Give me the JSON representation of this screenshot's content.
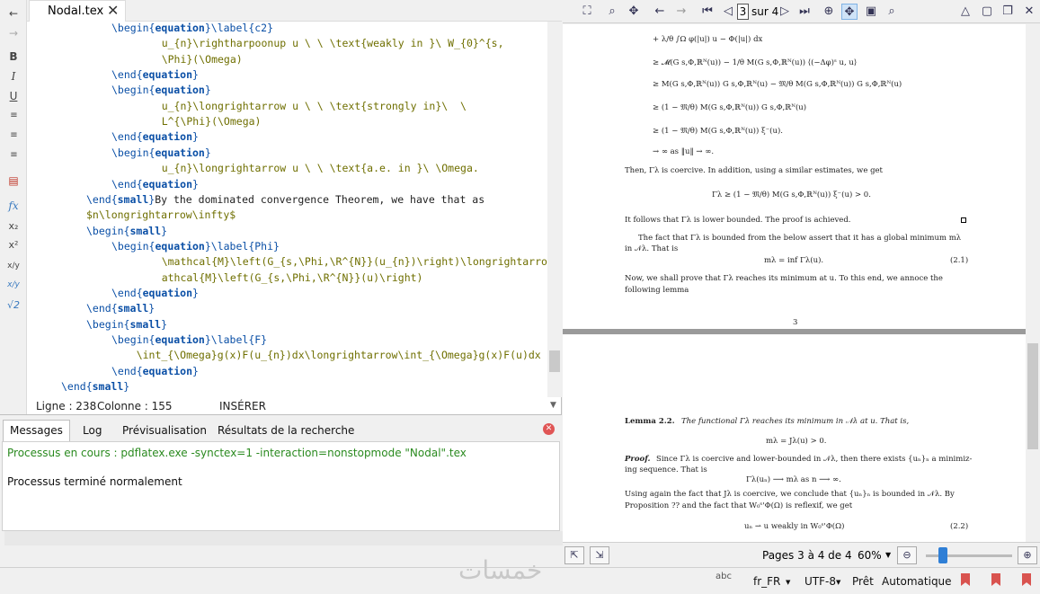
{
  "editor": {
    "tab_title": "Nodal.tex",
    "code_lines": [
      {
        "kw1": "\\begin{",
        "kwb": "equation",
        "kw2": "}\\label{c2}",
        "rest": ""
      },
      {
        "plain": "    u_{n}\\rightharpoonup u \\ \\ \\text{weakly in }\\ W_{0}^{s,"
      },
      {
        "plain": "    \\Phi}(\\Omega)"
      },
      {
        "kw1": "\\end{",
        "kwb": "equation",
        "kw2": "}",
        "rest": ""
      },
      {
        "kw1": "\\begin{",
        "kwb": "equation",
        "kw2": "}",
        "rest": ""
      },
      {
        "plain": "    u_{n}\\longrightarrow u \\ \\ \\text{strongly in}\\  \\"
      },
      {
        "plain": "    L^{\\Phi}(\\Omega)"
      },
      {
        "kw1": "\\end{",
        "kwb": "equation",
        "kw2": "}",
        "rest": ""
      },
      {
        "kw1": "\\begin{",
        "kwb": "equation",
        "kw2": "}",
        "rest": ""
      },
      {
        "plain": "    u_{n}\\longrightarrow u \\ \\ \\text{a.e. in }\\ \\Omega."
      },
      {
        "kw1": "\\end{",
        "kwb": "equation",
        "kw2": "}",
        "rest": ""
      },
      {
        "kw1": "\\end{",
        "kwb": "small",
        "kw2": "}",
        "rest": "By the dominated convergence Theorem, we have that as"
      },
      {
        "plain": "$n\\longrightarrow\\infty$"
      },
      {
        "kw1": "\\begin{",
        "kwb": "small",
        "kw2": "}",
        "rest": ""
      },
      {
        "kw1": "\\begin{",
        "kwb": "equation",
        "kw2": "}\\label{Phi}",
        "rest": ""
      },
      {
        "plain": "    \\mathcal{M}\\left(G_{s,\\Phi,\\R^{N}}(u_{n})\\right)\\longrightarrow\\m"
      },
      {
        "plain": "    athcal{M}\\left(G_{s,\\Phi,\\R^{N}}(u)\\right)"
      },
      {
        "kw1": "\\end{",
        "kwb": "equation",
        "kw2": "}",
        "rest": ""
      },
      {
        "kw1": "\\end{",
        "kwb": "small",
        "kw2": "}",
        "rest": ""
      },
      {
        "kw1": "\\begin{",
        "kwb": "small",
        "kw2": "}",
        "rest": ""
      },
      {
        "kw1": "\\begin{",
        "kwb": "equation",
        "kw2": "}\\label{F}",
        "rest": ""
      },
      {
        "plain": "    \\int_{\\Omega}g(x)F(u_{n})dx\\longrightarrow\\int_{\\Omega}g(x)F(u)dx"
      },
      {
        "kw1": "\\end{",
        "kwb": "equation",
        "kw2": "}",
        "rest": ""
      },
      {
        "kw1": "\\end{",
        "kwb": "small",
        "kw2": "}",
        "rest": ""
      }
    ],
    "status": {
      "line": "Ligne : 238",
      "column": "Colonne : 155",
      "mode": "INSÉRER"
    }
  },
  "messages": {
    "tabs": [
      "Messages",
      "Log",
      "Prévisualisation",
      "Résultats de la recherche"
    ],
    "running": "Processus en cours : pdflatex.exe -synctex=1 -interaction=nonstopmode \"Nodal\".tex",
    "done": "Processus terminé normalement"
  },
  "pdf": {
    "page_number": "3",
    "page_of": "sur 4",
    "page3_lines": [
      "+ λ/θ ∫Ω φ(|u|) u − Φ(|u|) dx",
      "≥ 𝓜(G s,Φ,ℝᴺ(u)) − 1/θ M(G s,Φ,ℝᴺ(u)) ⟨(−Δφ)ˢ u, u⟩",
      "≥ M(G s,Φ,ℝᴺ(u)) G s,Φ,ℝᴺ(u) − 𝔐/θ M(G s,Φ,ℝᴺ(u)) G s,Φ,ℝᴺ(u)",
      "≥ (1 − 𝔐/θ) M(G s,Φ,ℝᴺ(u)) G s,Φ,ℝᴺ(u)",
      "≥ (1 − 𝔐/θ) M(G s,Φ,ℝᴺ(u)) ξ⁻(u).",
      "→ ∞  as  ‖u‖ → ∞.",
      "Then, Γλ is coercive. In addition, using a similar estimates, we get",
      "Γλ ≥ (1 − 𝔐/θ) M(G s,Φ,ℝᴺ(u)) ξ⁻(u) > 0.",
      "It follows that Γλ is lower bounded. The proof is achieved.",
      "The fact that Γλ is bounded from the below assert that it has a global minimum mλ",
      "in 𝒩λ. That is",
      "mλ = inf Γλ(u).",
      "(2.1)",
      "Now, we shall prove that Γλ reaches its minimum at u. To this end, we annoce the",
      "following lemma",
      "3"
    ],
    "page4_lines": [
      "Lemma 2.2.",
      "The functional Γλ reaches its minimum in 𝒩λ at u. That is,",
      "mλ = Jλ(u) > 0.",
      "Proof.",
      "Since Γλ is coercive and lower-bounded in 𝒩λ, then there exists {uₙ}ₙ a minimiz-",
      "ing sequence. That is",
      "Γλ(uₙ) ⟶ mλ as n ⟶ ∞.",
      "Using again the fact that Jλ is coercive, we conclude that {uₙ}ₙ is bounded in 𝒩λ. By",
      "Proposition ?? and the fact that W₀ˢ'Φ(Ω) is reflexif, we get",
      "uₙ ⇀ u  weakly in  W₀ˢ'Φ(Ω)",
      "(2.2)"
    ],
    "pages_label": "Pages 3 à 4 de 4",
    "zoom": "60%",
    "zoom_fraction": 0.2
  },
  "statusbar": {
    "watermark": "خمسات",
    "spell_icon": "abc",
    "language": "fr_FR",
    "encoding": "UTF-8",
    "ready": "Prêt",
    "auto": "Automatique"
  }
}
